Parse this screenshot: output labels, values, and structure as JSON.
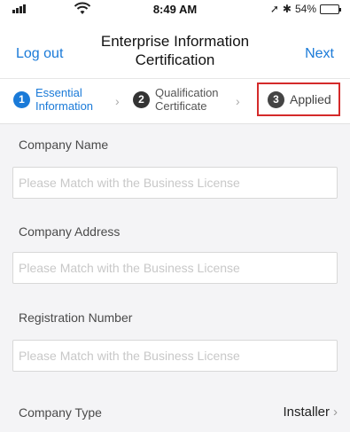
{
  "status": {
    "time": "8:49 AM",
    "battery_text": "54%",
    "battery_level": 0.54,
    "icons": [
      "cellular-signal-icon",
      "wifi-icon",
      "location-arrow-icon",
      "bluetooth-icon",
      "battery-icon"
    ]
  },
  "nav": {
    "back_label": "Log out",
    "title_line1": "Enterprise Information",
    "title_line2": "Certification",
    "next_label": "Next"
  },
  "steps": [
    {
      "number": "1",
      "line1": "Essential",
      "line2": "Information",
      "state": "active"
    },
    {
      "number": "2",
      "line1": "Qualification",
      "line2": "Certificate",
      "state": "inactive"
    },
    {
      "number": "3",
      "line1": "Applied",
      "line2": "",
      "state": "highlighted"
    }
  ],
  "step_separator": "›",
  "form": {
    "company_name": {
      "label": "Company Name",
      "placeholder": "Please Match with the Business License",
      "value": ""
    },
    "company_address": {
      "label": "Company Address",
      "placeholder": "Please Match with the Business License",
      "value": ""
    },
    "registration_number": {
      "label": "Registration Number",
      "placeholder": "Please Match with the Business License",
      "value": ""
    },
    "company_type": {
      "label": "Company Type",
      "value": "Installer",
      "chevron": "›"
    }
  },
  "colors": {
    "accent": "#1a7ad8",
    "highlight_box": "#d42a2a",
    "background": "#f4f4f6"
  }
}
